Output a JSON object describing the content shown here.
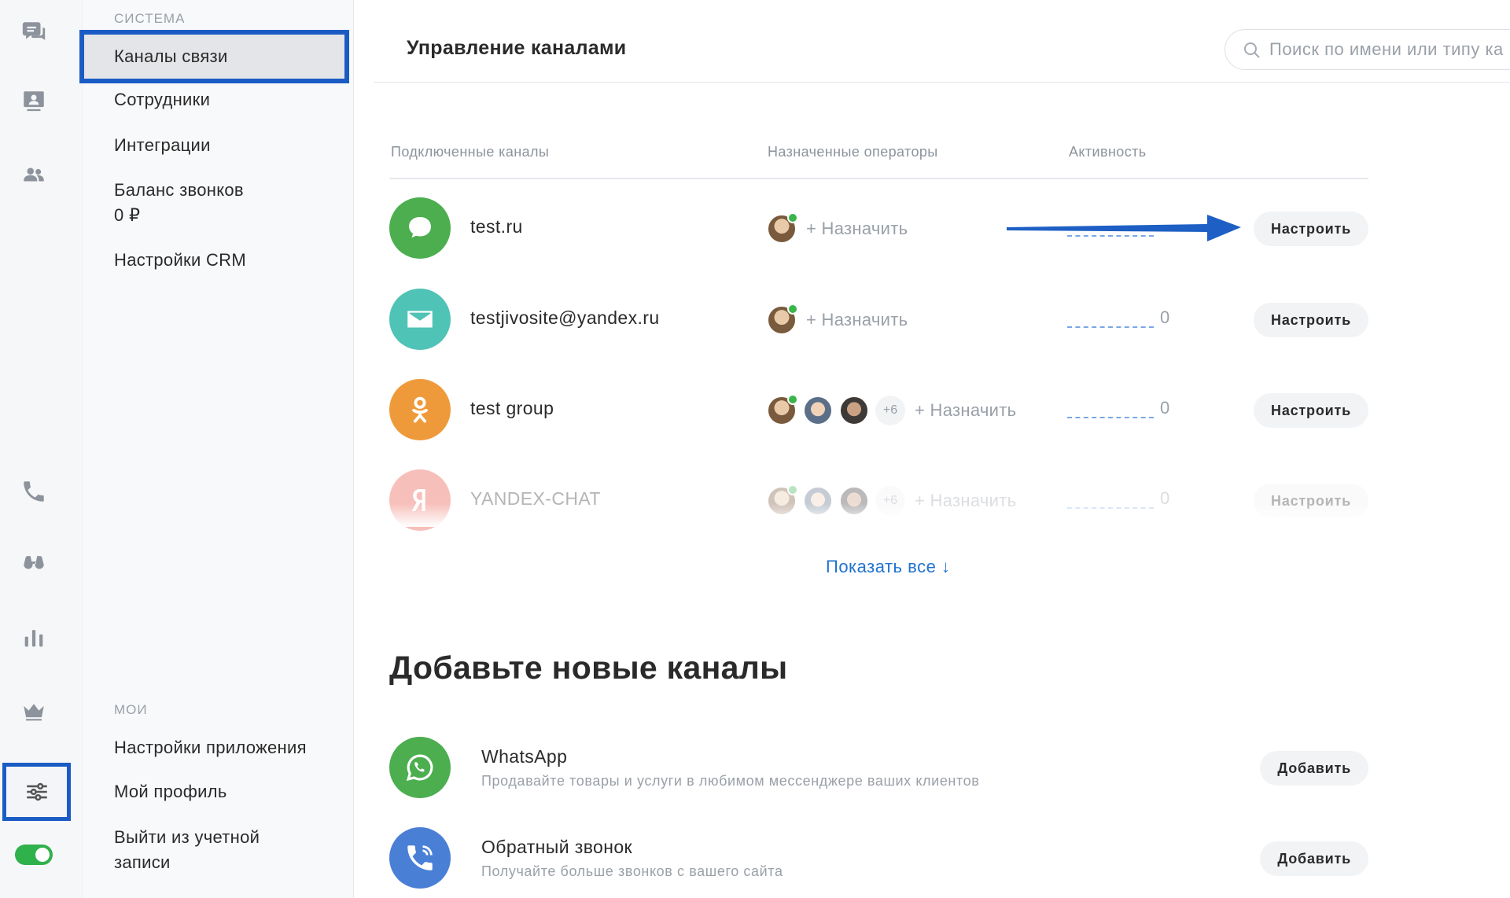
{
  "rail": {
    "items": [
      {
        "name": "chats-icon"
      },
      {
        "name": "visitors-icon"
      },
      {
        "name": "team-icon"
      },
      {
        "name": "phone-icon"
      },
      {
        "name": "binoculars-icon"
      },
      {
        "name": "stats-icon"
      },
      {
        "name": "crown-icon"
      },
      {
        "name": "settings-sliders-icon",
        "active": true
      }
    ],
    "status_toggle": "on"
  },
  "menu": {
    "system_section": "СИСТЕМА",
    "system_items": [
      "Каналы связи",
      "Сотрудники",
      "Интеграции",
      "Баланс звонков",
      "Настройки CRM"
    ],
    "balance_value": "0 ₽",
    "my_section": "МОИ",
    "my_items": [
      "Настройки приложения",
      "Мой профиль",
      "Выйти из учетной записи"
    ],
    "selected": "Каналы связи"
  },
  "header": {
    "title": "Управление каналами",
    "search_placeholder": "Поиск по имени или типу ка"
  },
  "table": {
    "columns": [
      "Подключенные каналы",
      "Назначенные операторы",
      "Активность"
    ],
    "rows": [
      {
        "name": "test.ru",
        "type": "chat",
        "color": "#4cae4f",
        "extra_ops": "",
        "assign": "+ Назначить",
        "activity": "",
        "button": "Настроить"
      },
      {
        "name": "testjivosite@yandex.ru",
        "type": "email",
        "color": "#4fc3b5",
        "extra_ops": "",
        "assign": "+ Назначить",
        "activity": "0",
        "button": "Настроить"
      },
      {
        "name": "test group",
        "type": "ok",
        "color": "#ef9a3a",
        "extra_ops": "+6",
        "assign": "+ Назначить",
        "activity": "0",
        "button": "Настроить"
      },
      {
        "name": "YANDEX-CHAT",
        "type": "yandex",
        "color": "#ea4b3c",
        "extra_ops": "+6",
        "assign": "+ Назначить",
        "activity": "0",
        "button": "Настроить"
      }
    ],
    "show_all": "Показать все ↓"
  },
  "add_channels": {
    "title": "Добавьте новые каналы",
    "items": [
      {
        "name": "WhatsApp",
        "desc": "Продавайте товары и услуги в любимом мессенджере ваших клиентов",
        "button": "Добавить",
        "color": "#4cae4f"
      },
      {
        "name": "Обратный звонок",
        "desc": "Получайте больше звонков с вашего сайта",
        "button": "Добавить",
        "color": "#4a7fd6"
      }
    ]
  },
  "colors": {
    "accent_border": "#1b5cc4",
    "link": "#1f72d0",
    "online": "#39b54a",
    "annotation_arrow": "#1d5fc4"
  }
}
